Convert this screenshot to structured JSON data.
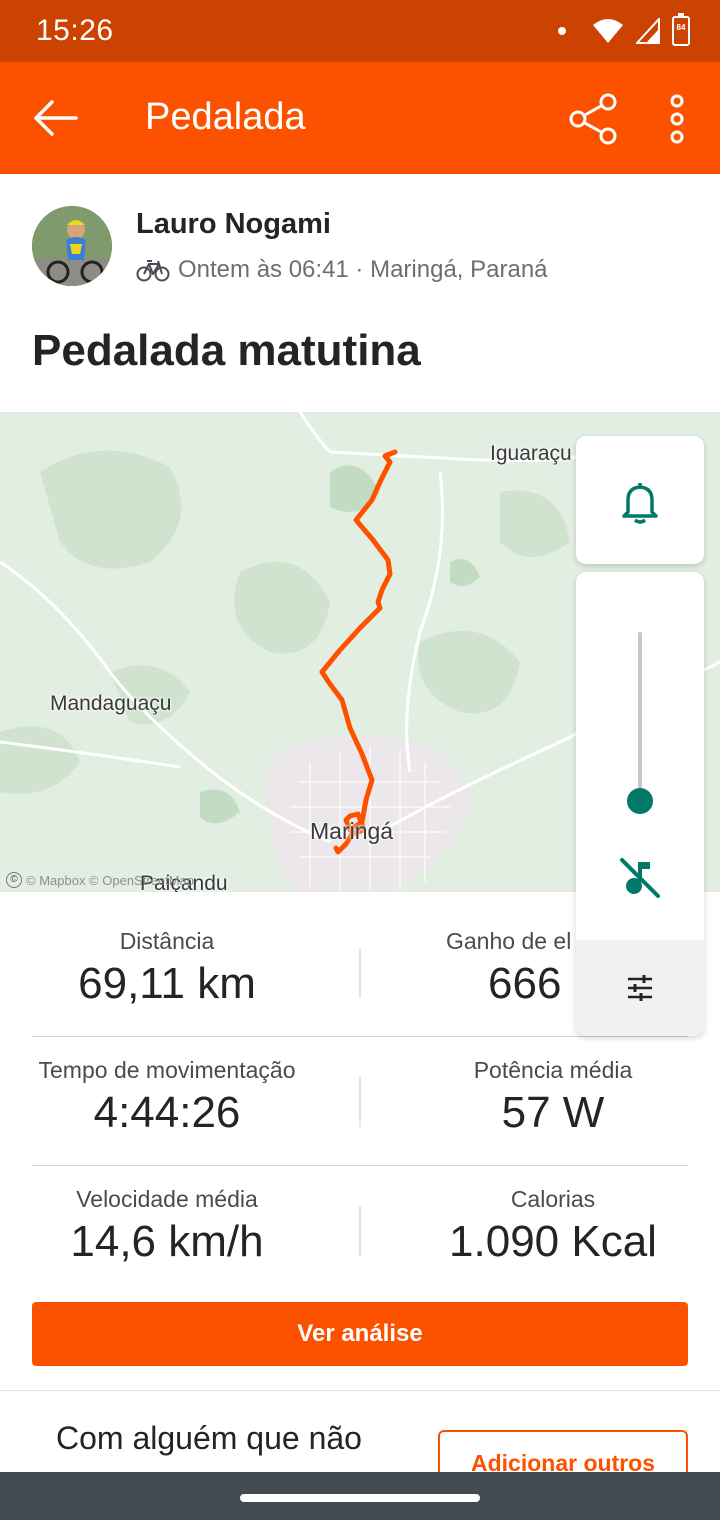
{
  "status_bar": {
    "time": "15:26",
    "battery": "84"
  },
  "app_bar": {
    "title": "Pedalada"
  },
  "athlete": {
    "name": "Lauro Nogami",
    "meta": "Ontem às 06:41 · Maringá, Paraná"
  },
  "activity": {
    "title": "Pedalada matutina"
  },
  "map": {
    "labels": {
      "iguaracu": "Iguaraçu",
      "mandaguacu": "Mandaguaçu",
      "maringa": "Maringá",
      "paicandu": "Paiçandu"
    },
    "attribution": "© Mapbox © OpenStreetMap",
    "route_color": "#fc5200"
  },
  "stats": {
    "distance": {
      "label": "Distância",
      "value": "69,11 km"
    },
    "elevation": {
      "label": "Ganho de el",
      "value": "666"
    },
    "moving_time": {
      "label": "Tempo de movimentação",
      "value": "4:44:26"
    },
    "avg_power": {
      "label": "Potência média",
      "value": "57 W"
    },
    "avg_speed": {
      "label": "Velocidade média",
      "value": "14,6 km/h"
    },
    "calories": {
      "label": "Calorias",
      "value": "1.090 Kcal"
    }
  },
  "buttons": {
    "analysis": "Ver análise",
    "add_others": "Adicionar outros"
  },
  "group": {
    "prompt": "Com alguém que não"
  },
  "volume_panel": {
    "level": 0.07,
    "accent": "#00796b"
  },
  "colors": {
    "brand": "#fc5200",
    "status_bar": "#cc4200",
    "nav_bar": "#444a52"
  }
}
